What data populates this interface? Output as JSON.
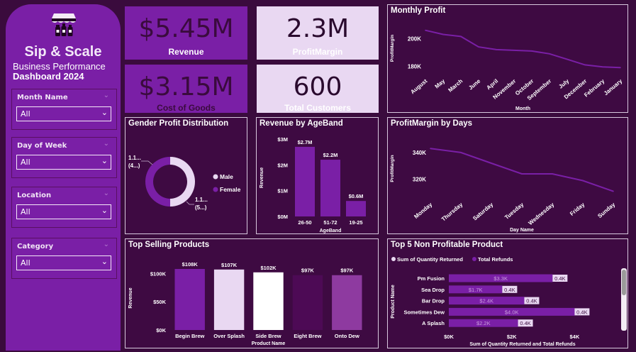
{
  "app": {
    "title": "Sip & Scale",
    "subtitle": "Business Performance",
    "year_line": "Dashboard  2024",
    "icon": "storefront-bottles-icon"
  },
  "filters": [
    {
      "label": "Month Name",
      "value": "All"
    },
    {
      "label": "Day of Week",
      "value": "All"
    },
    {
      "label": "Location",
      "value": "All"
    },
    {
      "label": "Category",
      "value": "All"
    }
  ],
  "kpis": {
    "revenue": {
      "value": "$5.45M",
      "label": "Revenue"
    },
    "profit_margin": {
      "value": "2.3M",
      "label": "ProfitMargin"
    },
    "cogs": {
      "value": "$3.15M",
      "label": "Cost of Goods"
    },
    "customers": {
      "value": "600",
      "label": "Total Customers"
    }
  },
  "colors": {
    "accent": "#7a1fa6",
    "light": "#e9d8f2",
    "background": "#3a0b3d",
    "line": "#7a1fa6"
  },
  "chart_data": [
    {
      "id": "monthly_profit",
      "type": "line",
      "title": "Monthly Profit",
      "xlabel": "Month",
      "ylabel": "ProfitMargin",
      "categories": [
        "August",
        "May",
        "March",
        "June",
        "April",
        "November",
        "October",
        "September",
        "July",
        "December",
        "February",
        "January"
      ],
      "values": [
        206000,
        203000,
        201500,
        194000,
        192000,
        191500,
        191000,
        189000,
        185000,
        181000,
        179500,
        179000
      ],
      "yticks": [
        "200K",
        "180K"
      ],
      "ytick_values": [
        200000,
        180000
      ],
      "ylim": [
        174000,
        212000
      ]
    },
    {
      "id": "gender_profit",
      "type": "pie",
      "title": "Gender Profit Distribution",
      "labels": [
        "Male",
        "Female"
      ],
      "values": [
        1.1,
        1.1
      ],
      "data_labels": [
        "1.1... (4...)",
        "1.1... (5...)"
      ],
      "colors": [
        "#e9d8f2",
        "#7a1fa6"
      ]
    },
    {
      "id": "revenue_ageband",
      "type": "bar",
      "title": "Revenue by AgeBand",
      "xlabel": "AgeBand",
      "ylabel": "Revenue",
      "categories": [
        "26-50",
        "51-72",
        "19-25"
      ],
      "values": [
        2.7,
        2.2,
        0.6
      ],
      "data_labels": [
        "$2.7M",
        "$2.2M",
        "$0.6M"
      ],
      "yticks": [
        "$3M",
        "$2M",
        "$1M",
        "$0M"
      ],
      "ytick_values": [
        3,
        2,
        1,
        0
      ],
      "ylim": [
        0,
        3
      ]
    },
    {
      "id": "profit_days",
      "type": "line",
      "title": "ProfitMargin by Days",
      "xlabel": "Day Name",
      "ylabel": "ProfitMargin",
      "categories": [
        "Monday",
        "Thursday",
        "Saturday",
        "Tuesday",
        "Wednesday",
        "Friday",
        "Sunday"
      ],
      "values": [
        343000,
        340000,
        332000,
        324000,
        324000,
        319000,
        311000
      ],
      "yticks": [
        "340K",
        "320K"
      ],
      "ytick_values": [
        340000,
        320000
      ],
      "ylim": [
        306000,
        350000
      ]
    },
    {
      "id": "top_selling",
      "type": "bar",
      "title": "Top Selling Products",
      "xlabel": "Product Name",
      "ylabel": "Revenue",
      "categories": [
        "Begin Brew",
        "Over Splash",
        "Side Brew",
        "Eight Brew",
        "Onto Dew"
      ],
      "values": [
        108,
        107,
        102,
        97,
        97
      ],
      "data_labels": [
        "$108K",
        "$107K",
        "$102K",
        "$97K",
        "$97K"
      ],
      "bar_colors": [
        "#7a1fa6",
        "#e9d8f2",
        "#ffffff",
        "#4d0a55",
        "#8e3aa0"
      ],
      "yticks": [
        "$100K",
        "$50K",
        "$0K"
      ],
      "ytick_values": [
        100,
        50,
        0
      ],
      "ylim": [
        0,
        113
      ]
    },
    {
      "id": "non_profitable",
      "type": "bar",
      "orientation": "horizontal",
      "title": "Top 5 Non Profitable Product",
      "xlabel": "Sum of Quantity Returned and Total Refunds",
      "ylabel": "Product Name",
      "categories": [
        "Pm Fusion",
        "Sea Drop",
        "Bar Drop",
        "Sometimes Dew",
        "A Splash"
      ],
      "series": [
        {
          "name": "Sum of Quantity Returned",
          "values": [
            0.4,
            0.4,
            0.4,
            0.4,
            0.4
          ],
          "data_labels": [
            "0.4K",
            "0.4K",
            "0.4K",
            "0.4K",
            "0.4K"
          ]
        },
        {
          "name": "Total Refunds",
          "values": [
            3.3,
            1.7,
            2.4,
            4.0,
            2.2
          ],
          "data_labels": [
            "$3.3K",
            "$1.7K",
            "$2.4K",
            "$4.0K",
            "$2.2K"
          ]
        }
      ],
      "xticks": [
        "$0K",
        "$2K",
        "$4K"
      ],
      "xtick_values": [
        0,
        2,
        4
      ],
      "xlim": [
        0,
        4.6
      ]
    }
  ]
}
